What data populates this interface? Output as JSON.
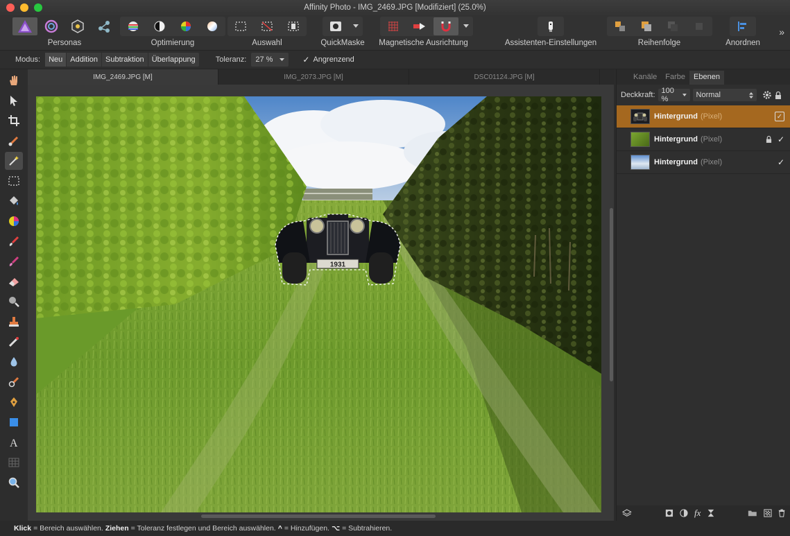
{
  "window": {
    "title": "Affinity Photo - IMG_2469.JPG [Modifiziert] (25.0%)"
  },
  "toolbar": {
    "groups": [
      {
        "label": "Personas",
        "icons": [
          "photo-persona-icon",
          "liquify-persona-icon",
          "develop-persona-icon",
          "export-persona-icon"
        ]
      },
      {
        "label": "Optimierung",
        "icons": [
          "auto-levels-icon",
          "auto-contrast-icon",
          "auto-colors-icon",
          "auto-white-balance-icon"
        ]
      },
      {
        "label": "Auswahl",
        "icons": [
          "select-all-icon",
          "deselect-icon",
          "invert-selection-icon"
        ]
      },
      {
        "label": "QuickMaske",
        "icons": [
          "quick-mask-icon"
        ]
      },
      {
        "label": "Magnetische Ausrichtung",
        "icons": [
          "grid-snapping-icon",
          "snap-to-icon",
          "magnet-icon"
        ]
      },
      {
        "label": "Assistenten-Einstellungen",
        "icons": [
          "assistant-icon"
        ]
      },
      {
        "label": "Reihenfolge",
        "icons": [
          "move-to-back-icon",
          "move-back-icon",
          "move-forward-icon",
          "move-to-front-icon"
        ]
      },
      {
        "label": "Anordnen",
        "icons": [
          "align-icon"
        ]
      }
    ],
    "expand": "»"
  },
  "context": {
    "mode_label": "Modus:",
    "modes": [
      "Neu",
      "Addition",
      "Subtraktion",
      "Überlappung"
    ],
    "active_mode": "Neu",
    "tolerance_label": "Toleranz:",
    "tolerance_value": "27 %",
    "contiguous_label": "Angrenzend",
    "contiguous_checked": true
  },
  "tools": [
    "view-hand-icon",
    "move-pointer-icon",
    "crop-icon",
    "selection-brush-icon",
    "flood-select-wand-icon",
    "marquee-icon",
    "flood-fill-icon",
    "gradient-icon",
    "paint-brush-icon",
    "color-replacement-icon",
    "erase-brush-icon",
    "dodge-icon",
    "clone-stamp-icon",
    "healing-icon",
    "blur-drop-icon",
    "smudge-icon",
    "pen-icon",
    "rectangle-shape-icon",
    "text-icon",
    "mesh-warp-icon",
    "zoom-icon"
  ],
  "document_tabs": [
    "IMG_2469.JPG [M]",
    "IMG_2073.JPG [M]",
    "DSC01124.JPG [M]"
  ],
  "canvas": {
    "plate_text": "1931"
  },
  "panel": {
    "tabs": [
      "Kanäle",
      "Farbe",
      "Ebenen"
    ],
    "active_tab": "Ebenen",
    "opacity_label": "Deckkraft:",
    "opacity_value": "100 %",
    "blend_mode": "Normal",
    "layers": [
      {
        "name": "Hintergrund",
        "type": "(Pixel)"
      },
      {
        "name": "Hintergrund",
        "type": "(Pixel)"
      },
      {
        "name": "Hintergrund",
        "type": "(Pixel)"
      }
    ]
  },
  "status": {
    "k1": "Klick",
    "t1": "= Bereich auswählen.",
    "k2": "Ziehen",
    "t2": "= Toleranz festlegen und Bereich auswählen.",
    "k3": "^",
    "t3": "= Hinzufügen.",
    "k4": "⌥",
    "t4": "= Subtrahieren."
  },
  "colors": {
    "accent": "#a5681f",
    "panel_bg": "#2f2f2f",
    "toolbar_bg": "#323232"
  }
}
